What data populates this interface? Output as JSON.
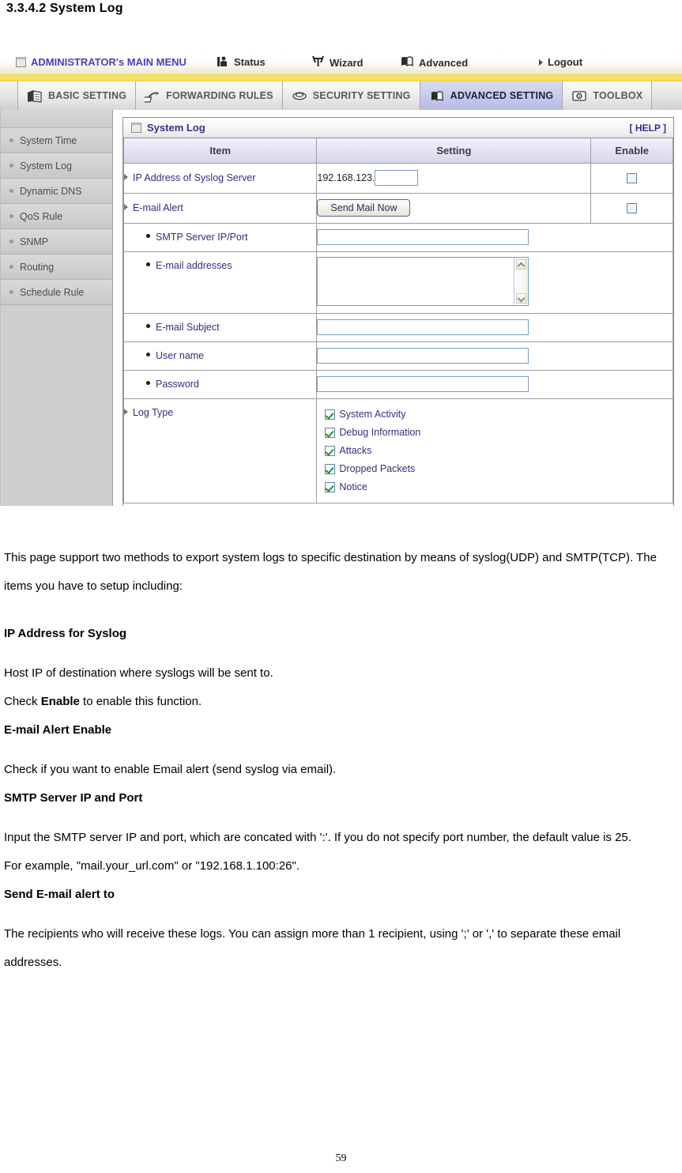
{
  "document": {
    "heading": "3.3.4.2 System Log",
    "page_number": "59"
  },
  "router_ui": {
    "top_menu": {
      "admin_label": "ADMINISTRATOR's MAIN MENU",
      "status_label": "Status",
      "wizard_label": "Wizard",
      "advanced_label": "Advanced",
      "logout_label": "Logout"
    },
    "tabs": [
      {
        "label": "BASIC SETTING",
        "active": false
      },
      {
        "label": "FORWARDING RULES",
        "active": false
      },
      {
        "label": "SECURITY SETTING",
        "active": false
      },
      {
        "label": "ADVANCED SETTING",
        "active": true
      },
      {
        "label": "TOOLBOX",
        "active": false
      }
    ],
    "sidebar": {
      "items": [
        {
          "label": "System Time"
        },
        {
          "label": "System Log"
        },
        {
          "label": "Dynamic DNS"
        },
        {
          "label": "QoS Rule"
        },
        {
          "label": "SNMP"
        },
        {
          "label": "Routing"
        },
        {
          "label": "Schedule Rule"
        }
      ]
    },
    "panel": {
      "title": "System Log",
      "help_label": "[ HELP ]",
      "columns": {
        "item": "Item",
        "setting": "Setting",
        "enable": "Enable"
      },
      "rows": {
        "syslog_ip": {
          "label": "IP Address of Syslog Server",
          "ip_prefix": "192.168.123.",
          "ip_suffix_value": "",
          "enabled": false
        },
        "email_alert": {
          "label": "E-mail Alert",
          "button_label": "Send Mail Now",
          "enabled": false
        },
        "smtp_server": {
          "label": "SMTP Server IP/Port",
          "value": ""
        },
        "email_addresses": {
          "label": "E-mail addresses",
          "value": ""
        },
        "email_subject": {
          "label": "E-mail Subject",
          "value": ""
        },
        "user_name": {
          "label": "User name",
          "value": ""
        },
        "password": {
          "label": "Password",
          "value": ""
        },
        "log_type": {
          "label": "Log Type",
          "options": [
            {
              "label": "System Activity",
              "checked": true
            },
            {
              "label": "Debug Information",
              "checked": true
            },
            {
              "label": "Attacks",
              "checked": true
            },
            {
              "label": "Dropped Packets",
              "checked": true
            },
            {
              "label": "Notice",
              "checked": true
            }
          ]
        }
      }
    },
    "colors": {
      "menu_accent": "#4a3fb8",
      "strip_yellow": "#f3d94b",
      "active_tab": "#c5caea",
      "panel_heading_text": "#31318f",
      "check_green": "#1f8b2a"
    }
  },
  "prose": {
    "intro": "This page support two methods to export system logs to specific destination by means of syslog(UDP) and SMTP(TCP). The items you have to setup including:",
    "h_ip_syslog": "IP Address for Syslog",
    "p_host_ip": "Host IP of destination where syslogs will be sent to.",
    "p_check_enable_pre": "Check ",
    "p_check_enable_bold": "Enable",
    "p_check_enable_post": " to enable this function.",
    "h_email_alert": "E-mail Alert Enable",
    "p_email_alert": "Check if you want to enable Email alert (send syslog via email).",
    "h_smtp": "SMTP Server IP and Port",
    "p_smtp_1": "Input the SMTP server IP and port, which are concated with ':'. If you do not specify port number, the default value is 25.",
    "p_smtp_2": "For example, \"mail.your_url.com\" or \"192.168.1.100:26\".",
    "h_send_to": "Send E-mail alert to",
    "p_send_to": "The recipients who will receive these logs. You can assign more than 1 recipient, using ';' or ',' to separate these email addresses."
  }
}
